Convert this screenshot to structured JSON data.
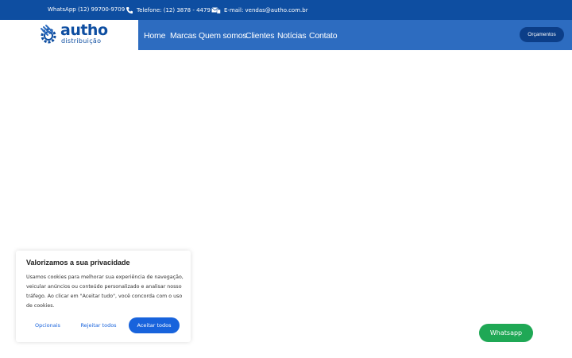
{
  "topbar": {
    "whatsapp": "WhatsApp (12) 99700-9709",
    "telefone": "Telefone: (12) 3878 - 4479",
    "email": "E-mail: vendas@autho.com.br"
  },
  "logo": {
    "word": "autho",
    "sub": "distribuição"
  },
  "nav": {
    "items": [
      "Home",
      "Marcas",
      "Quem somos",
      "Clientes",
      "Notícias",
      "Contato"
    ],
    "cta": "Orçamentos"
  },
  "cookie": {
    "title": "Valorizamos a sua privacidade",
    "text": "Usamos cookies para melhorar sua experiência de navegação, veicular anúncios ou conteúdo personalizado e analisar nosso tráfego. Ao clicar em \"Aceitar tudo\", você concorda com o uso de cookies.",
    "optional": "Opcionais",
    "reject": "Rejeitar todos",
    "accept": "Aceitar todos"
  },
  "whatsapp_button": "Whatsapp",
  "colors": {
    "topbar": "#0e4ea1",
    "nav": "#2d6cc0",
    "cta": "#0c3e88",
    "cookie_accent": "#1863dc",
    "whatsapp": "#1fa855"
  }
}
